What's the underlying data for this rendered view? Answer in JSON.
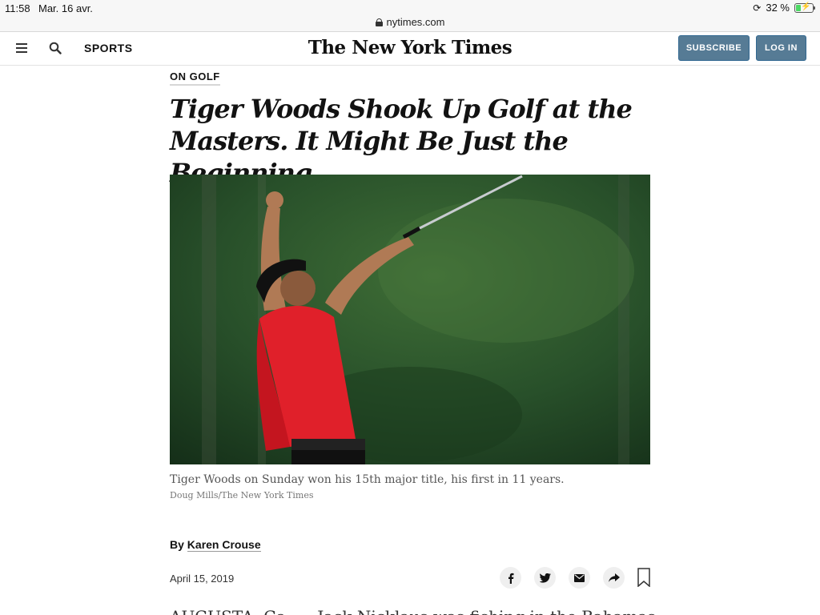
{
  "status_bar": {
    "time": "11:58",
    "date": "Mar. 16 avr.",
    "battery_text": "32 %",
    "battery_level": 0.32
  },
  "url_bar": {
    "domain": "nytimes.com"
  },
  "header": {
    "section": "SPORTS",
    "masthead": "The New York Times",
    "subscribe_label": "SUBSCRIBE",
    "login_label": "LOG IN"
  },
  "article": {
    "kicker": "ON GOLF",
    "headline_line1": "Tiger Woods Shook Up Golf at the",
    "headline_line2": "Masters. It Might Be Just the Beginning.",
    "caption": "Tiger Woods on Sunday won his 15th major title, his first in 11 years.",
    "credit": "Doug Mills/The New York Times",
    "byline_prefix": "By ",
    "author": "Karen Crouse",
    "date": "April 15, 2019",
    "body_start": "AUGUSTA, Ga. — Jack Nicklaus was fishing in the Bahamas"
  },
  "colors": {
    "button_bg": "#567b95",
    "shirt_red": "#e0202a",
    "foliage_green": "#2e5a2a"
  }
}
